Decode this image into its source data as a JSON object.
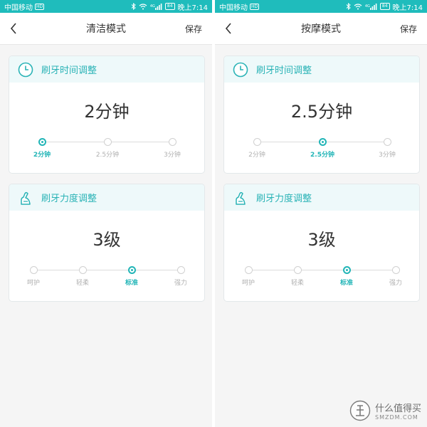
{
  "status": {
    "carrier": "中国移动",
    "hd": "HD",
    "signal_label": "4G",
    "battery": "84",
    "time": "晚上7:14"
  },
  "screens": [
    {
      "title": "清洁模式",
      "save_label": "保存",
      "time_card": {
        "title": "刷牙时间调整",
        "value": "2分钟",
        "options": [
          "2分钟",
          "2.5分钟",
          "3分钟"
        ],
        "selected_index": 0
      },
      "force_card": {
        "title": "刷牙力度调整",
        "value": "3级",
        "options": [
          "呵护",
          "轻柔",
          "标准",
          "强力"
        ],
        "selected_index": 2
      }
    },
    {
      "title": "按摩模式",
      "save_label": "保存",
      "time_card": {
        "title": "刷牙时间调整",
        "value": "2.5分钟",
        "options": [
          "2分钟",
          "2.5分钟",
          "3分钟"
        ],
        "selected_index": 1
      },
      "force_card": {
        "title": "刷牙力度调整",
        "value": "3级",
        "options": [
          "呵护",
          "轻柔",
          "标准",
          "强力"
        ],
        "selected_index": 2
      }
    }
  ],
  "watermark": {
    "main": "什么值得买",
    "sub": "SMZDM.COM"
  },
  "colors": {
    "accent": "#22b5b7",
    "status_bar": "#1fbcbc",
    "card_header": "#eef9fa"
  },
  "icons": {
    "back": "chevron-left-icon",
    "time": "clock-icon",
    "force": "toothbrush-icon"
  }
}
